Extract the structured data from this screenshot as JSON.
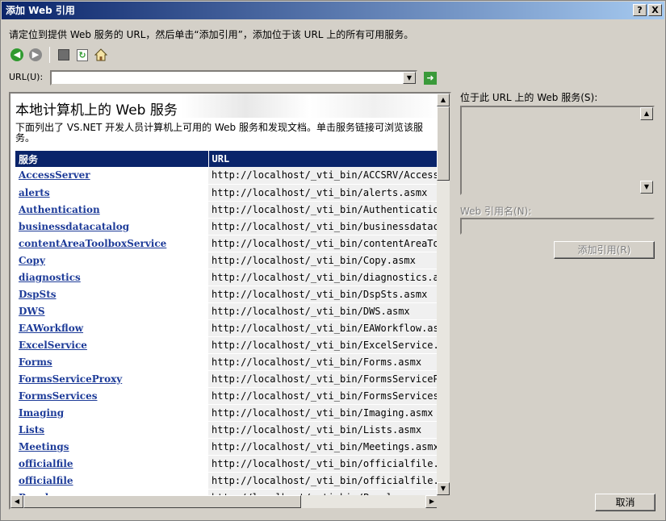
{
  "window": {
    "title": "添加 Web 引用",
    "help_btn": "?",
    "close_btn": "X"
  },
  "instruction": "请定位到提供 Web 服务的 URL，然后单击“添加引用”，添加位于该 URL 上的所有可用服务。",
  "toolbar": {
    "icons": [
      "back-icon",
      "forward-icon",
      "stop-icon",
      "refresh-icon",
      "home-icon"
    ]
  },
  "url_bar": {
    "label": "URL(U):",
    "value": "",
    "placeholder": ""
  },
  "browser": {
    "heading": "本地计算机上的 Web 服务",
    "description": "下面列出了 VS.NET 开发人员计算机上可用的 Web 服务和发现文档。单击服务链接可浏览该服务。",
    "col_service": "服务",
    "col_url": "URL",
    "rows": [
      {
        "name": "AccessServer",
        "url": "http://localhost/_vti_bin/ACCSRV/AccessS"
      },
      {
        "name": "alerts",
        "url": "http://localhost/_vti_bin/alerts.asmx"
      },
      {
        "name": "Authentication",
        "url": "http://localhost/_vti_bin/Authentication"
      },
      {
        "name": "businessdatacatalog",
        "url": "http://localhost/_vti_bin/businessdataca"
      },
      {
        "name": "contentAreaToolboxService",
        "url": "http://localhost/_vti_bin/contentAreaToo"
      },
      {
        "name": "Copy",
        "url": "http://localhost/_vti_bin/Copy.asmx"
      },
      {
        "name": "diagnostics",
        "url": "http://localhost/_vti_bin/diagnostics.as"
      },
      {
        "name": "DspSts",
        "url": "http://localhost/_vti_bin/DspSts.asmx"
      },
      {
        "name": "DWS",
        "url": "http://localhost/_vti_bin/DWS.asmx"
      },
      {
        "name": "EAWorkflow",
        "url": "http://localhost/_vti_bin/EAWorkflow.asmx"
      },
      {
        "name": "ExcelService",
        "url": "http://localhost/_vti_bin/ExcelService.a"
      },
      {
        "name": "Forms",
        "url": "http://localhost/_vti_bin/Forms.asmx"
      },
      {
        "name": "FormsServiceProxy",
        "url": "http://localhost/_vti_bin/FormsServicePr"
      },
      {
        "name": "FormsServices",
        "url": "http://localhost/_vti_bin/FormsServices."
      },
      {
        "name": "Imaging",
        "url": "http://localhost/_vti_bin/Imaging.asmx"
      },
      {
        "name": "Lists",
        "url": "http://localhost/_vti_bin/Lists.asmx"
      },
      {
        "name": "Meetings",
        "url": "http://localhost/_vti_bin/Meetings.asmx"
      },
      {
        "name": "officialfile",
        "url": "http://localhost/_vti_bin/officialfile.a"
      },
      {
        "name": "officialfile",
        "url": "http://localhost/_vti_bin/officialfile.w"
      },
      {
        "name": "People",
        "url": "http://localhost/_vti_bin/People.asmx"
      }
    ]
  },
  "side": {
    "services_label": "位于此 URL 上的 Web 服务(S):",
    "ref_name_label": "Web 引用名(N):",
    "ref_name_value": "",
    "add_ref_btn": "添加引用(R)",
    "cancel_btn": "取消"
  }
}
